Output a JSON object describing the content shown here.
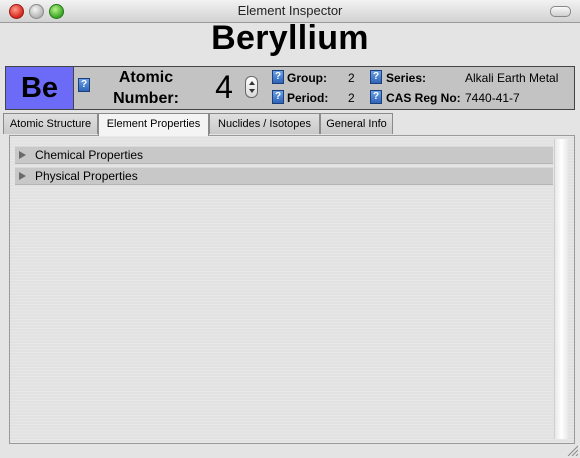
{
  "window": {
    "title": "Element Inspector"
  },
  "element": {
    "name": "Beryllium",
    "symbol": "Be",
    "symbol_color": "#6b6bf7",
    "atomic_number_label": "Atomic Number:",
    "atomic_number": "4",
    "group_label": "Group:",
    "group": "2",
    "period_label": "Period:",
    "period": "2",
    "series_label": "Series:",
    "series": "Alkali Earth Metal",
    "cas_label": "CAS Reg No:",
    "cas": "7440-41-7",
    "help_glyph": "?"
  },
  "tabs": [
    {
      "label": "Atomic Structure"
    },
    {
      "label": "Element Properties",
      "active": true
    },
    {
      "label": "Nuclides / Isotopes"
    },
    {
      "label": "General Info"
    }
  ],
  "sections": [
    {
      "label": "Chemical Properties",
      "expanded": false
    },
    {
      "label": "Physical Properties",
      "expanded": false
    }
  ]
}
